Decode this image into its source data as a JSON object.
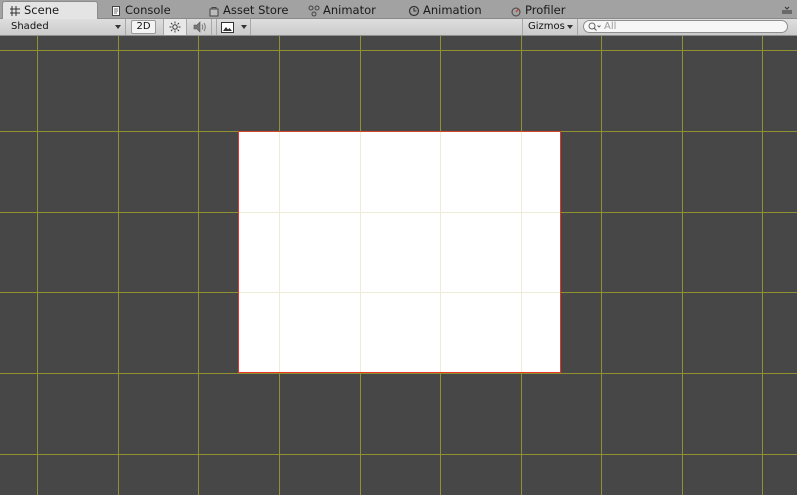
{
  "tabs": [
    {
      "label": "Scene",
      "icon": "grid-icon",
      "active": true
    },
    {
      "label": "Console",
      "icon": "console-icon",
      "active": false
    },
    {
      "label": "Asset Store",
      "icon": "asset-store-icon",
      "active": false
    },
    {
      "label": "Animator",
      "icon": "animator-icon",
      "active": false
    },
    {
      "label": "Animation",
      "icon": "animation-clock-icon",
      "active": false
    },
    {
      "label": "Profiler",
      "icon": "profiler-icon",
      "active": false
    }
  ],
  "toolbar": {
    "draw_mode": "Shaded",
    "mode_2d": "2D",
    "lighting_icon": "sun-icon",
    "audio_icon": "speaker-icon",
    "effects_icon": "image-icon",
    "gizmos_label": "Gizmos",
    "search_placeholder": "All"
  },
  "scene": {
    "grid_color": "#9c9c2e",
    "background_color": "#474747",
    "sprite_fill": "#ffffff",
    "sprite_outline": "#e5352b"
  }
}
